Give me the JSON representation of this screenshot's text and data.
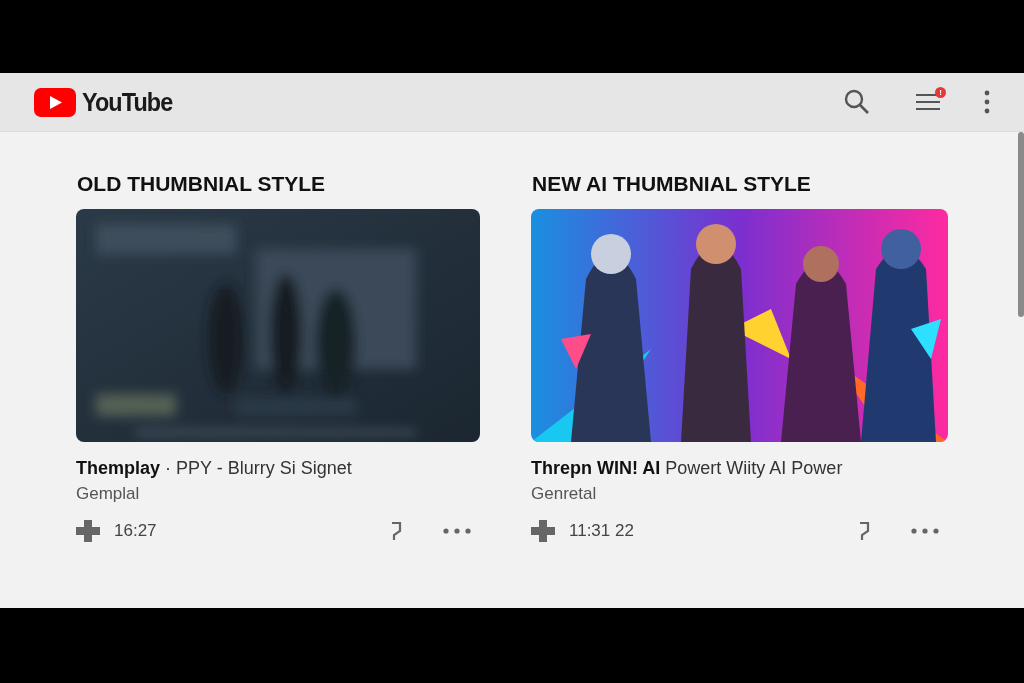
{
  "header": {
    "logo_text": "YouTube",
    "notification_badge": "!"
  },
  "videos": [
    {
      "section_title": "OLD THUMBNIAL STYLE",
      "title": "**Themplay** · PPY - Blurry Si Signet",
      "channel": "Gemplal",
      "duration": "16:27"
    },
    {
      "section_title": "NEW AI THUMBNIAL STYLE",
      "title": "**Threpn WIN! AI** Powert Wiity AI Power",
      "channel": "Genretal",
      "duration": "11:31 22"
    }
  ]
}
